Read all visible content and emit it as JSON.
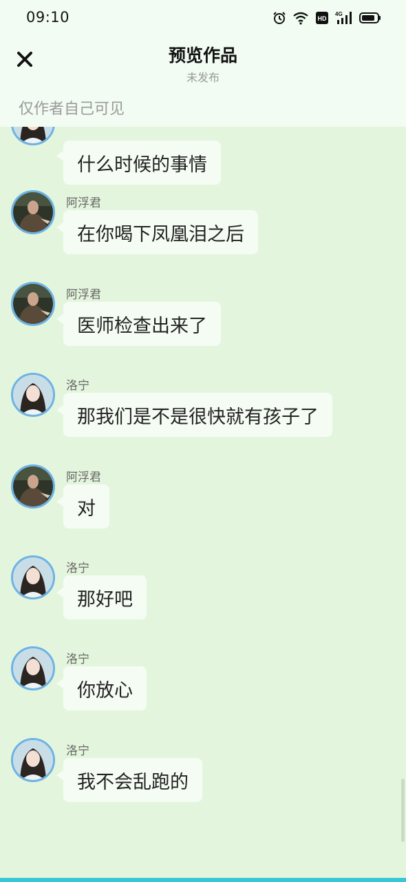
{
  "status_bar": {
    "time": "09:10",
    "icons": [
      "alarm-icon",
      "wifi-icon",
      "hd-icon",
      "signal-4g-icon",
      "battery-icon"
    ],
    "network_label": "4G",
    "hd_label": "HD"
  },
  "header": {
    "close_icon": "close-icon",
    "title": "预览作品",
    "subtitle": "未发布",
    "visibility_note": "仅作者自己可见"
  },
  "characters": {
    "afujun": {
      "name": "阿浮君",
      "avatar": "afujun-avatar"
    },
    "luoning": {
      "name": "洛宁",
      "avatar": "luoning-avatar"
    }
  },
  "messages": [
    {
      "sender": "",
      "avatar": "luoning-avatar",
      "text": "什么时候的事情"
    },
    {
      "sender": "阿浮君",
      "avatar": "afujun-avatar",
      "text": "在你喝下凤凰泪之后"
    },
    {
      "sender": "阿浮君",
      "avatar": "afujun-avatar",
      "text": "医师检查出来了"
    },
    {
      "sender": "洛宁",
      "avatar": "luoning-avatar",
      "text": "那我们是不是很快就有孩子了"
    },
    {
      "sender": "阿浮君",
      "avatar": "afujun-avatar",
      "text": "对"
    },
    {
      "sender": "洛宁",
      "avatar": "luoning-avatar",
      "text": "那好吧"
    },
    {
      "sender": "洛宁",
      "avatar": "luoning-avatar",
      "text": "你放心"
    },
    {
      "sender": "洛宁",
      "avatar": "luoning-avatar",
      "text": "我不会乱跑的"
    }
  ],
  "colors": {
    "chat_background": "#e4f5dd",
    "header_background": "#f2fcf2",
    "bubble": "#f4fcf3",
    "avatar_ring": "#6bb3e6",
    "bottom_accent": "#38c7d6"
  }
}
